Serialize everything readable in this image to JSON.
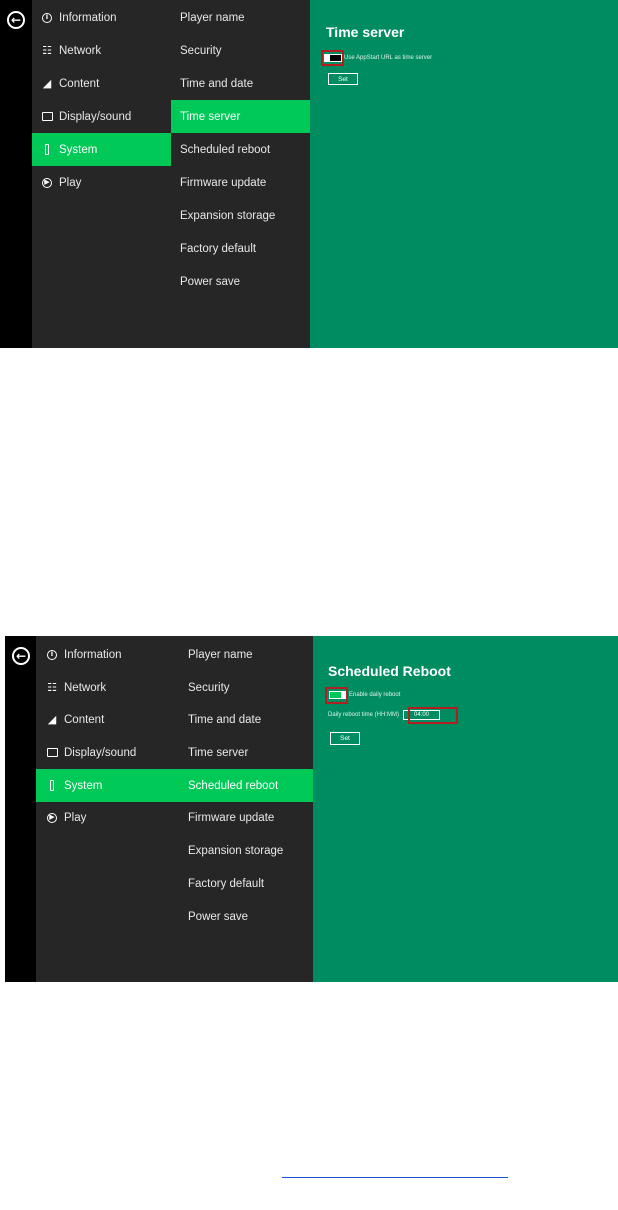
{
  "screenshots": [
    {
      "main_menu": {
        "items": [
          {
            "label": "Information",
            "icon": "info-icon"
          },
          {
            "label": "Network",
            "icon": "network-icon"
          },
          {
            "label": "Content",
            "icon": "clapperboard-icon"
          },
          {
            "label": "Display/sound",
            "icon": "display-icon"
          },
          {
            "label": "System",
            "icon": "system-icon",
            "active": true
          },
          {
            "label": "Play",
            "icon": "play-icon"
          }
        ]
      },
      "sub_menu": {
        "items": [
          {
            "label": "Player name"
          },
          {
            "label": "Security"
          },
          {
            "label": "Time and date"
          },
          {
            "label": "Time server",
            "active": true
          },
          {
            "label": "Scheduled reboot"
          },
          {
            "label": "Firmware update"
          },
          {
            "label": "Expansion storage"
          },
          {
            "label": "Factory default"
          },
          {
            "label": "Power save"
          }
        ]
      },
      "panel": {
        "title": "Time server",
        "toggle_label": "Use AppStart URL as time server",
        "toggle_state": "off",
        "set_label": "Set"
      }
    },
    {
      "main_menu": {
        "items": [
          {
            "label": "Information",
            "icon": "info-icon"
          },
          {
            "label": "Network",
            "icon": "network-icon"
          },
          {
            "label": "Content",
            "icon": "clapperboard-icon"
          },
          {
            "label": "Display/sound",
            "icon": "display-icon"
          },
          {
            "label": "System",
            "icon": "system-icon",
            "active": true
          },
          {
            "label": "Play",
            "icon": "play-icon"
          }
        ]
      },
      "sub_menu": {
        "items": [
          {
            "label": "Player name"
          },
          {
            "label": "Security"
          },
          {
            "label": "Time and date"
          },
          {
            "label": "Time server"
          },
          {
            "label": "Scheduled reboot",
            "active": true
          },
          {
            "label": "Firmware update"
          },
          {
            "label": "Expansion storage"
          },
          {
            "label": "Factory default"
          },
          {
            "label": "Power save"
          }
        ]
      },
      "panel": {
        "title": "Scheduled Reboot",
        "toggle_label": "Enable daily reboot",
        "toggle_state": "on",
        "time_label": "Daily reboot time (HH:MM)",
        "time_value": "04:00",
        "set_label": "Set"
      }
    }
  ],
  "colors": {
    "panel_green": "#008c61",
    "accent_green": "#00c957",
    "menu_bg": "#262626",
    "highlight_red": "#b21f1f"
  }
}
